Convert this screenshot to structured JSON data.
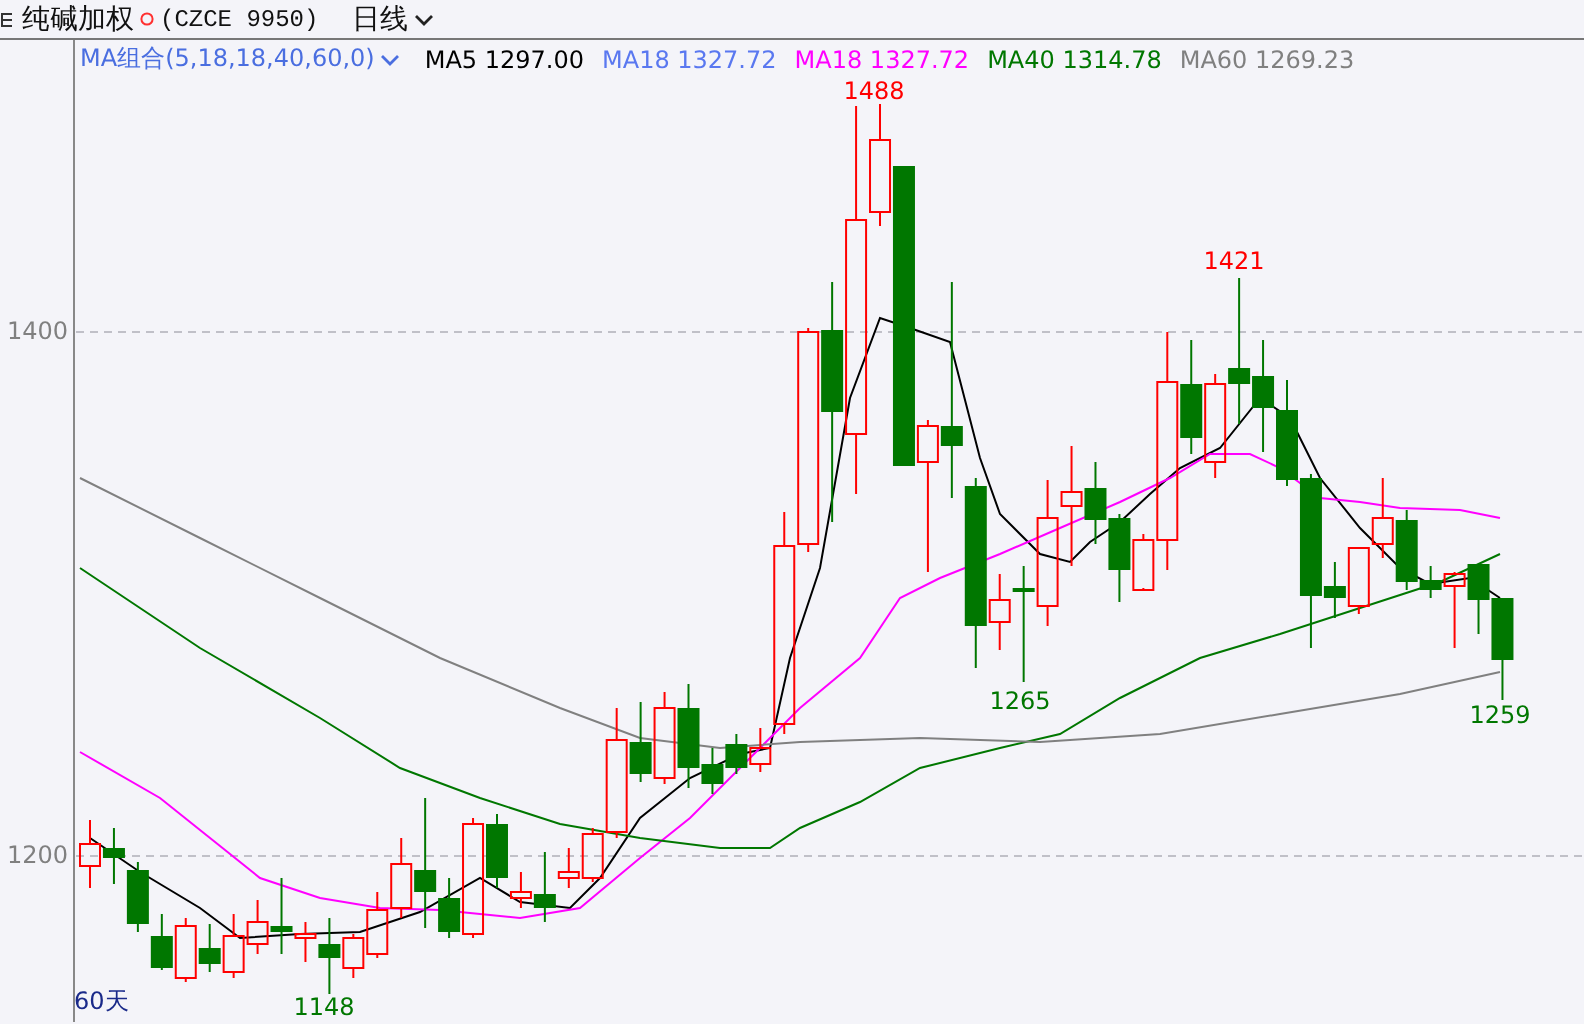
{
  "header": {
    "title": "纯碱加权",
    "code": "(CZCE 9950)",
    "period": "日线"
  },
  "legend": [
    {
      "label": "MA组合(5,18,18,40,60,0)",
      "color": "#4a6ee0",
      "kind": "selector"
    },
    {
      "label": "MA5 1297.00",
      "color": "#000000",
      "kind": "value"
    },
    {
      "label": "MA18 1327.72",
      "color": "#5a78f0",
      "kind": "value"
    },
    {
      "label": "MA18 1327.72",
      "color": "#ff00ff",
      "kind": "value"
    },
    {
      "label": "MA40 1314.78",
      "color": "#007700",
      "kind": "value"
    },
    {
      "label": "MA60 1269.23",
      "color": "#808080",
      "kind": "value"
    }
  ],
  "chart": {
    "y_labels": [
      "1400",
      "1200"
    ],
    "annotations": [
      {
        "text": "1488",
        "kind": "high"
      },
      {
        "text": "1421",
        "kind": "high"
      },
      {
        "text": "1265",
        "kind": "low"
      },
      {
        "text": "1259",
        "kind": "low"
      },
      {
        "text": "1148",
        "kind": "low"
      }
    ],
    "range_label": "60天"
  }
}
